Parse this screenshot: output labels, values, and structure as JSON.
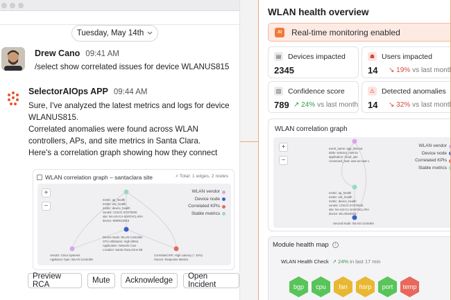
{
  "chat": {
    "date_label": "Tuesday, May 14th",
    "messages": [
      {
        "author": "Drew Cano",
        "time": "09:41 AM",
        "text": "/select show correlated issues for device WLANUS815"
      },
      {
        "author": "SelectorAIOps APP",
        "time": "09:44 AM",
        "lines": [
          "Sure, I've analyzed the latest metrics and logs for device",
          "WLANUS815.",
          "Correlated anomalies were found across WLAN",
          "controllers, APs, and site metrics in Santa Clara.",
          "Here's a correlation graph showing how they connect"
        ]
      }
    ],
    "attachment": {
      "title": "WLAN correlation graph – santaclara site",
      "total": "Total: 1 edges, 2 nodes",
      "zoom_in": "+",
      "zoom_out": "−",
      "legend": [
        {
          "label": "WLAN vendor",
          "color": "#d7a6ea"
        },
        {
          "label": "Device node",
          "color": "#3b5fc4"
        },
        {
          "label": "Correlated KPIs",
          "color": "#e8685c"
        },
        {
          "label": "Stable metrics",
          "color": "#9ad9c0"
        }
      ],
      "node_texts": {
        "top": [
          "metric: ap_health",
          "metric: wlc_health",
          "metric: device_health",
          "vendor: CISCO SYSTEMS",
          "site: NA-US-CA-SANTACLARA",
          "device: WWNUS815"
        ],
        "center": [
          "Device Node: WLAN Controller",
          "CPU Utilization: High (95%)",
          "Application: Network Core",
          "Location: Santa Clara Zone 5B"
        ],
        "left": [
          "Vendor: Cisco Systems",
          "Appliance Type: WLAN Controller"
        ],
        "right": [
          "Correlated KPI: High Latency (↑ 34%)",
          "Source: Response Metrics"
        ]
      }
    },
    "actions": [
      "Preview RCA",
      "Mute",
      "Acknowledge",
      "Open Incident"
    ]
  },
  "panel": {
    "title": "WLAN health overview",
    "banner": "Real-time monitoring enabled",
    "banner_icon": "AI",
    "cards": [
      {
        "label": "Devices impacted",
        "value": "2345",
        "trend": "",
        "note": ""
      },
      {
        "label": "Users impacted",
        "value": "14",
        "trend": "↘ 19%",
        "trend_dir": "down",
        "note": "vs last month"
      },
      {
        "label": "Confidence score",
        "value": "789",
        "trend": "↗ 24%",
        "trend_dir": "up",
        "note": "vs last month"
      },
      {
        "label": "Detected anomalies",
        "value": "14",
        "trend": "↘ 32%",
        "trend_dir": "down",
        "note": "vs last month"
      }
    ],
    "graph": {
      "title": "WLAN correlation graph",
      "zoom_in": "+",
      "zoom_out": "−",
      "legend": [
        {
          "label": "WLAN vendor",
          "color": "#d7a6ea"
        },
        {
          "label": "Device node",
          "color": "#3b5fc4"
        },
        {
          "label": "Correlated KPIs",
          "color": "#e8685c"
        },
        {
          "label": "Stable metrics",
          "color": "#9ad9c0"
        }
      ],
      "top_texts": [
        "event_name: app_timeout",
        "table: selector_metrics",
        "application: cloud_ops",
        "connected_host: aws-az-east-1"
      ],
      "mid_texts": [
        "metric: ap_health",
        "metric: wlc_health",
        "metric: device_health",
        "vendor: CISCO SYSTEMS",
        "site: NA-US-CA-SANTACLARA",
        "device: WLANUS815"
      ],
      "bottom_text": "Second Node: WLAN Controller"
    },
    "module": {
      "title": "Module health map",
      "check_label": "WLAN Health Check",
      "check_trend": "↗ 24%",
      "check_note": "in last 17 min",
      "hexes": [
        {
          "label": "bgp",
          "color": "#58c45a"
        },
        {
          "label": "cpu",
          "color": "#58c45a"
        },
        {
          "label": "fan",
          "color": "#e8b833"
        },
        {
          "label": "hsrp",
          "color": "#e8b833"
        },
        {
          "label": "port",
          "color": "#58c45a"
        },
        {
          "label": "temp",
          "color": "#e8685c"
        }
      ]
    }
  }
}
